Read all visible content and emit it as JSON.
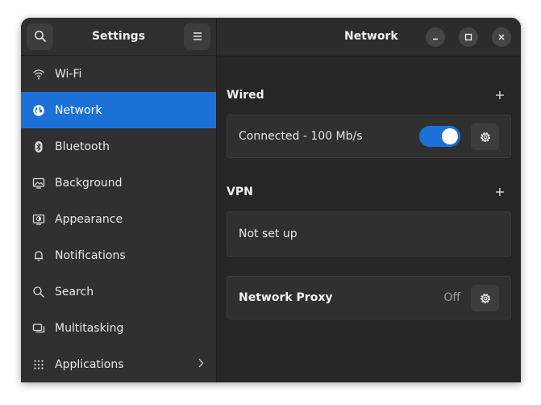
{
  "sidebar": {
    "title": "Settings",
    "items": [
      {
        "label": "Wi-Fi",
        "icon": "wifi-icon"
      },
      {
        "label": "Network",
        "icon": "globe-icon",
        "active": true
      },
      {
        "label": "Bluetooth",
        "icon": "bluetooth-icon"
      },
      {
        "label": "Background",
        "icon": "background-icon"
      },
      {
        "label": "Appearance",
        "icon": "appearance-icon"
      },
      {
        "label": "Notifications",
        "icon": "bell-icon"
      },
      {
        "label": "Search",
        "icon": "search-icon"
      },
      {
        "label": "Multitasking",
        "icon": "multitasking-icon"
      },
      {
        "label": "Applications",
        "icon": "grid-icon",
        "has_submenu": true
      }
    ]
  },
  "header": {
    "title": "Network"
  },
  "main": {
    "wired": {
      "title": "Wired",
      "connection_status": "Connected - 100 Mb/s",
      "toggle_on": true
    },
    "vpn": {
      "title": "VPN",
      "status": "Not set up"
    },
    "proxy": {
      "title": "Network Proxy",
      "status": "Off"
    }
  },
  "colors": {
    "accent": "#1c71d8",
    "sidebar_bg": "#303030",
    "content_bg": "#262626",
    "card_bg": "#303030",
    "text": "#e8e8e8",
    "muted_text": "#9a9a9a"
  }
}
